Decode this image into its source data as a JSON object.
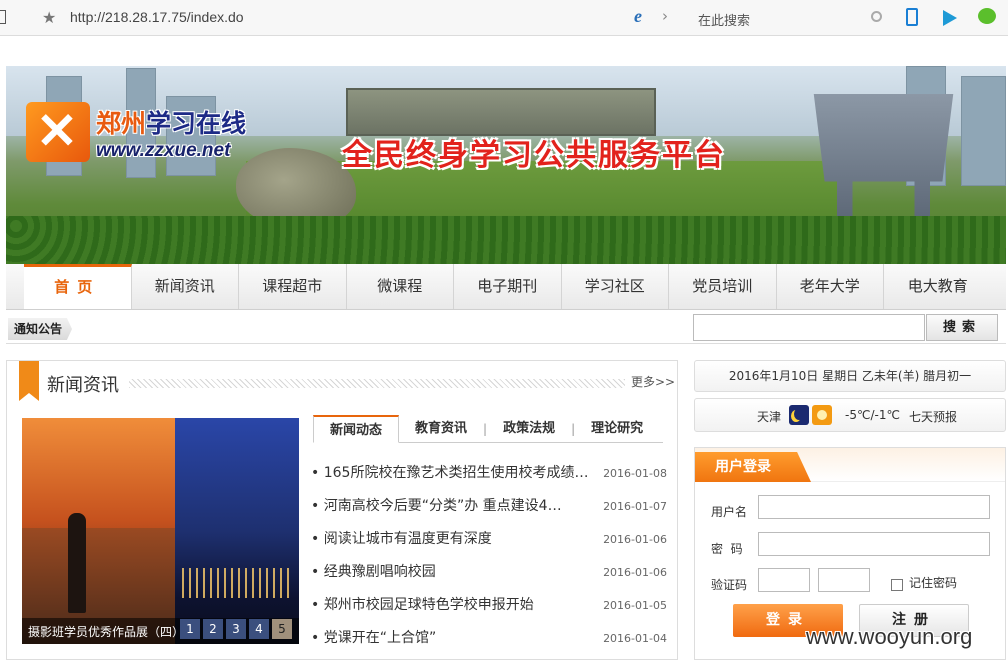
{
  "browser": {
    "url": "http://218.28.17.75/index.do",
    "search_placeholder": "在此搜索"
  },
  "banner": {
    "logo_name_a": "郑州",
    "logo_name_b": "学习在线",
    "logo_url": "www.zzxue.net",
    "slogan": "全民终身学习公共服务平台"
  },
  "nav": {
    "items": [
      "首页",
      "新闻资讯",
      "课程超市",
      "微课程",
      "电子期刊",
      "学习社区",
      "党员培训",
      "老年大学",
      "电大教育"
    ],
    "active": "首页"
  },
  "notice": {
    "tag": "通知公告",
    "search_button": "搜索",
    "search_value": ""
  },
  "news": {
    "title": "新闻资讯",
    "more": "更多>>",
    "tabs": [
      "新闻动态",
      "教育资讯",
      "政策法规",
      "理论研究"
    ],
    "active_tab": "新闻动态",
    "items": [
      {
        "title": "165所院校在豫艺术类招生使用校考成绩…",
        "date": "2016-01-08"
      },
      {
        "title": "河南高校今后要“分类”办 重点建设4…",
        "date": "2016-01-07"
      },
      {
        "title": "阅读让城市有温度更有深度",
        "date": "2016-01-06"
      },
      {
        "title": "经典豫剧唱响校园",
        "date": "2016-01-06"
      },
      {
        "title": "郑州市校园足球特色学校申报开始",
        "date": "2016-01-05"
      },
      {
        "title": "党课开在“上合馆”",
        "date": "2016-01-04"
      }
    ],
    "slideshow": {
      "caption": "摄影班学员优秀作品展（四）",
      "pages": [
        "1",
        "2",
        "3",
        "4",
        "5"
      ],
      "active_page": "5"
    }
  },
  "date": {
    "text": "2016年1月10日  星期日  乙未年(羊)  腊月初一"
  },
  "weather": {
    "city": "天津",
    "temp": "-5℃/-1℃",
    "forecast": "七天预报",
    "icons": [
      "moon-icon",
      "sun-icon"
    ]
  },
  "login": {
    "title": "用户登录",
    "username_label": "用户名",
    "password_label": "密  码",
    "captcha_label": "验证码",
    "remember_label": "记住密码",
    "login_button": "登录",
    "register_button": "注册"
  },
  "watermark": "www.wooyun.org",
  "colors": {
    "accent": "#e8650c",
    "login_button": "#f06a10"
  }
}
